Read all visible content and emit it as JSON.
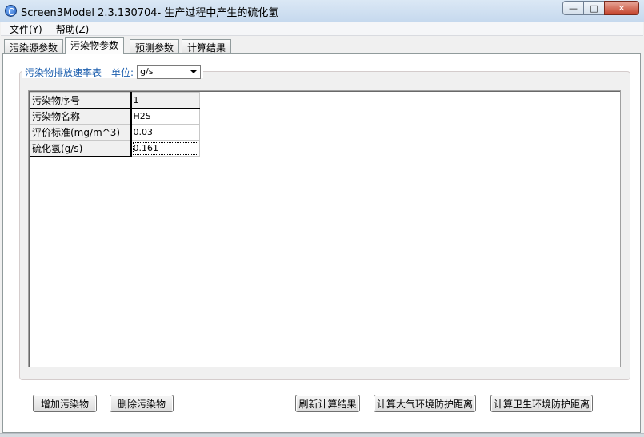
{
  "window": {
    "title": "Screen3Model 2.3.130704- 生产过程中产生的硫化氢",
    "minimize_glyph": "—",
    "maximize_glyph": "□",
    "close_glyph": "✕"
  },
  "menu": {
    "items": [
      "文件(Y)",
      "帮助(Z)"
    ]
  },
  "tabs": [
    {
      "label": "污染源参数",
      "active": false
    },
    {
      "label": "污染物参数",
      "active": true
    },
    {
      "label": "预测参数",
      "active": false
    },
    {
      "label": "计算结果",
      "active": false
    }
  ],
  "group": {
    "title": "污染物排放速率表",
    "unit_label": "单位:",
    "unit_value": "g/s"
  },
  "grid": {
    "rows": [
      {
        "header": "污染物序号",
        "value": "1"
      },
      {
        "header": "污染物名称",
        "value": "H2S"
      },
      {
        "header": "评价标准(mg/m^3)",
        "value": "0.03"
      },
      {
        "header": "硫化氢(g/s)",
        "value": "0.161"
      }
    ]
  },
  "buttons": {
    "add": "增加污染物",
    "delete": "删除污染物",
    "refresh": "刷新计算结果",
    "atmos": "计算大气环境防护距离",
    "health": "计算卫生环境防护距离"
  }
}
